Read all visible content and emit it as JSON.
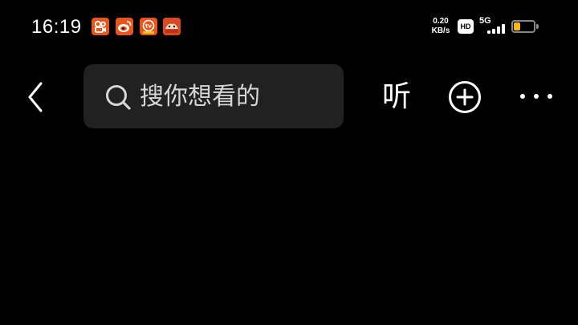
{
  "status_bar": {
    "time": "16:19",
    "app_icons": [
      "kuaishou-icon",
      "weibo-icon",
      "youku-tv-icon",
      "game-app-icon"
    ],
    "net_speed_value": "0.20",
    "net_speed_unit": "KB/s",
    "hd_label": "HD",
    "network_type": "5G",
    "signal_level": 4,
    "battery_level": 0.35,
    "battery_color": "#f6b51a"
  },
  "top_bar": {
    "search_placeholder": "搜你想看的",
    "listen_label": "听",
    "back_icon": "chevron-left-icon",
    "add_icon": "plus-circle-icon",
    "more_icon": "more-horizontal-icon"
  },
  "colors": {
    "background": "#000000",
    "search_bg": "#212121",
    "text": "#ffffff"
  }
}
